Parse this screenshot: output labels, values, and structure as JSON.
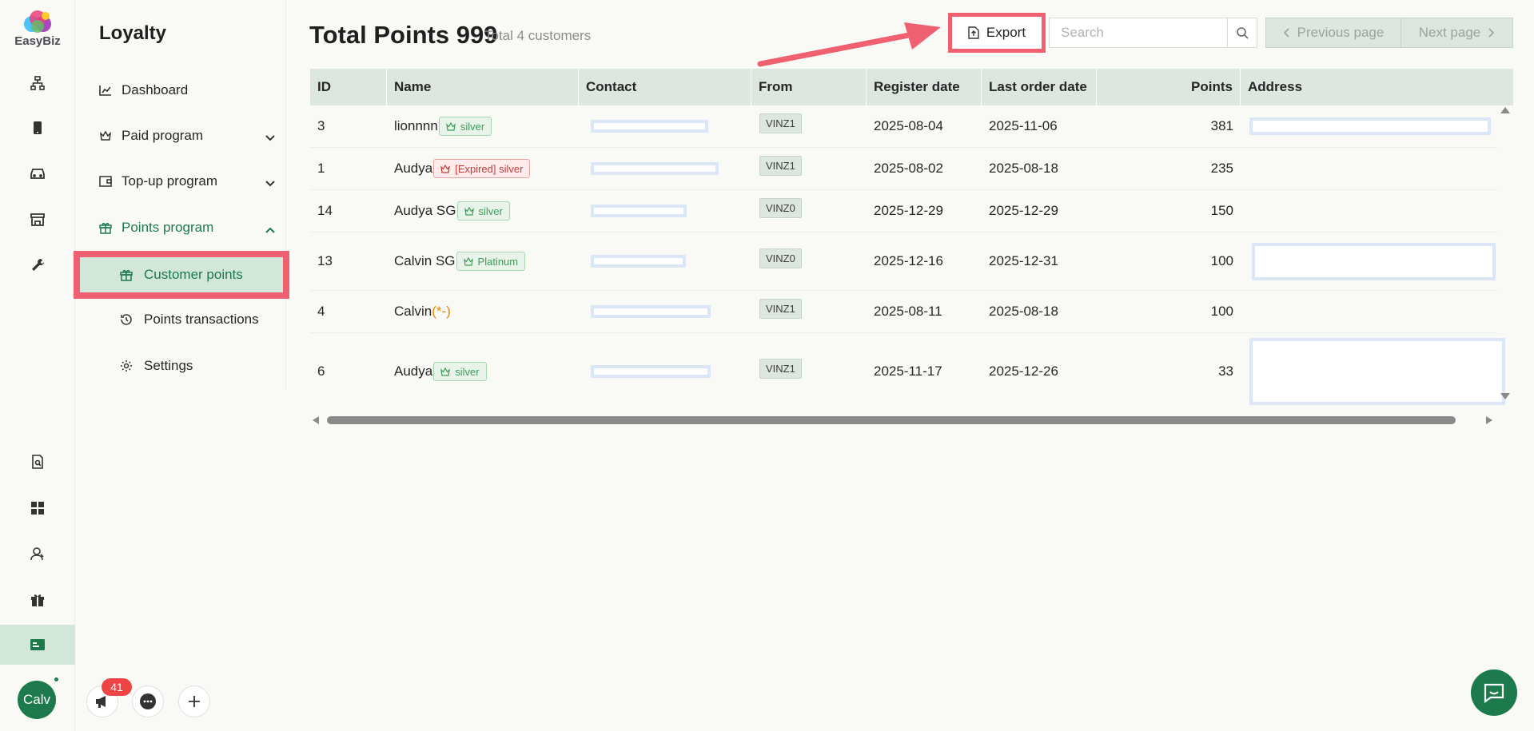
{
  "brand": {
    "name": "EasyBiz"
  },
  "user": {
    "avatar_text": "Calv"
  },
  "notifications": {
    "count": "41"
  },
  "menu": {
    "title": "Loyalty",
    "items": [
      {
        "label": "Dashboard",
        "icon": "chart-icon"
      },
      {
        "label": "Paid program",
        "icon": "crown-icon"
      },
      {
        "label": "Top-up program",
        "icon": "wallet-icon"
      },
      {
        "label": "Points program",
        "icon": "gift-icon"
      }
    ],
    "sub_items": [
      {
        "label": "Customer points",
        "icon": "gift-icon",
        "active": true
      },
      {
        "label": "Points transactions",
        "icon": "history-icon"
      },
      {
        "label": "Settings",
        "icon": "gear-icon"
      }
    ]
  },
  "header": {
    "title": "Total Points 999",
    "subtitle": "Total 4 customers",
    "export_label": "Export",
    "search_placeholder": "Search",
    "prev_label": "Previous page",
    "next_label": "Next page"
  },
  "table": {
    "columns": [
      "ID",
      "Name",
      "Contact",
      "From",
      "Register date",
      "Last order date",
      "Points",
      "Address"
    ],
    "rows": [
      {
        "id": "3",
        "name": "lionnnn",
        "tag": "silver",
        "tag_style": "green",
        "from": "VINZ1",
        "register": "2025-08-04",
        "last_order": "2025-11-06",
        "points": "381"
      },
      {
        "id": "1",
        "name": "Audya",
        "tag": "[Expired] silver",
        "tag_style": "red",
        "from": "VINZ1",
        "register": "2025-08-02",
        "last_order": "2025-08-18",
        "points": "235"
      },
      {
        "id": "14",
        "name": "Audya SG",
        "tag": "silver",
        "tag_style": "green",
        "from": "VINZ0",
        "register": "2025-12-29",
        "last_order": "2025-12-29",
        "points": "150"
      },
      {
        "id": "13",
        "name": "Calvin SG",
        "tag": "Platinum",
        "tag_style": "green",
        "from": "VINZ0",
        "register": "2025-12-16",
        "last_order": "2025-12-31",
        "points": "100"
      },
      {
        "id": "4",
        "name": "Calvin",
        "name_suffix": "(*-)",
        "from": "VINZ1",
        "register": "2025-08-11",
        "last_order": "2025-08-18",
        "points": "100"
      },
      {
        "id": "6",
        "name": "Audya",
        "tag": "silver",
        "tag_style": "green",
        "from": "VINZ1",
        "register": "2025-11-17",
        "last_order": "2025-12-26",
        "points": "33"
      }
    ]
  },
  "colors": {
    "brand_green": "#1c7a4c",
    "highlight_red": "#ef6070",
    "header_bg": "#dde6df"
  }
}
